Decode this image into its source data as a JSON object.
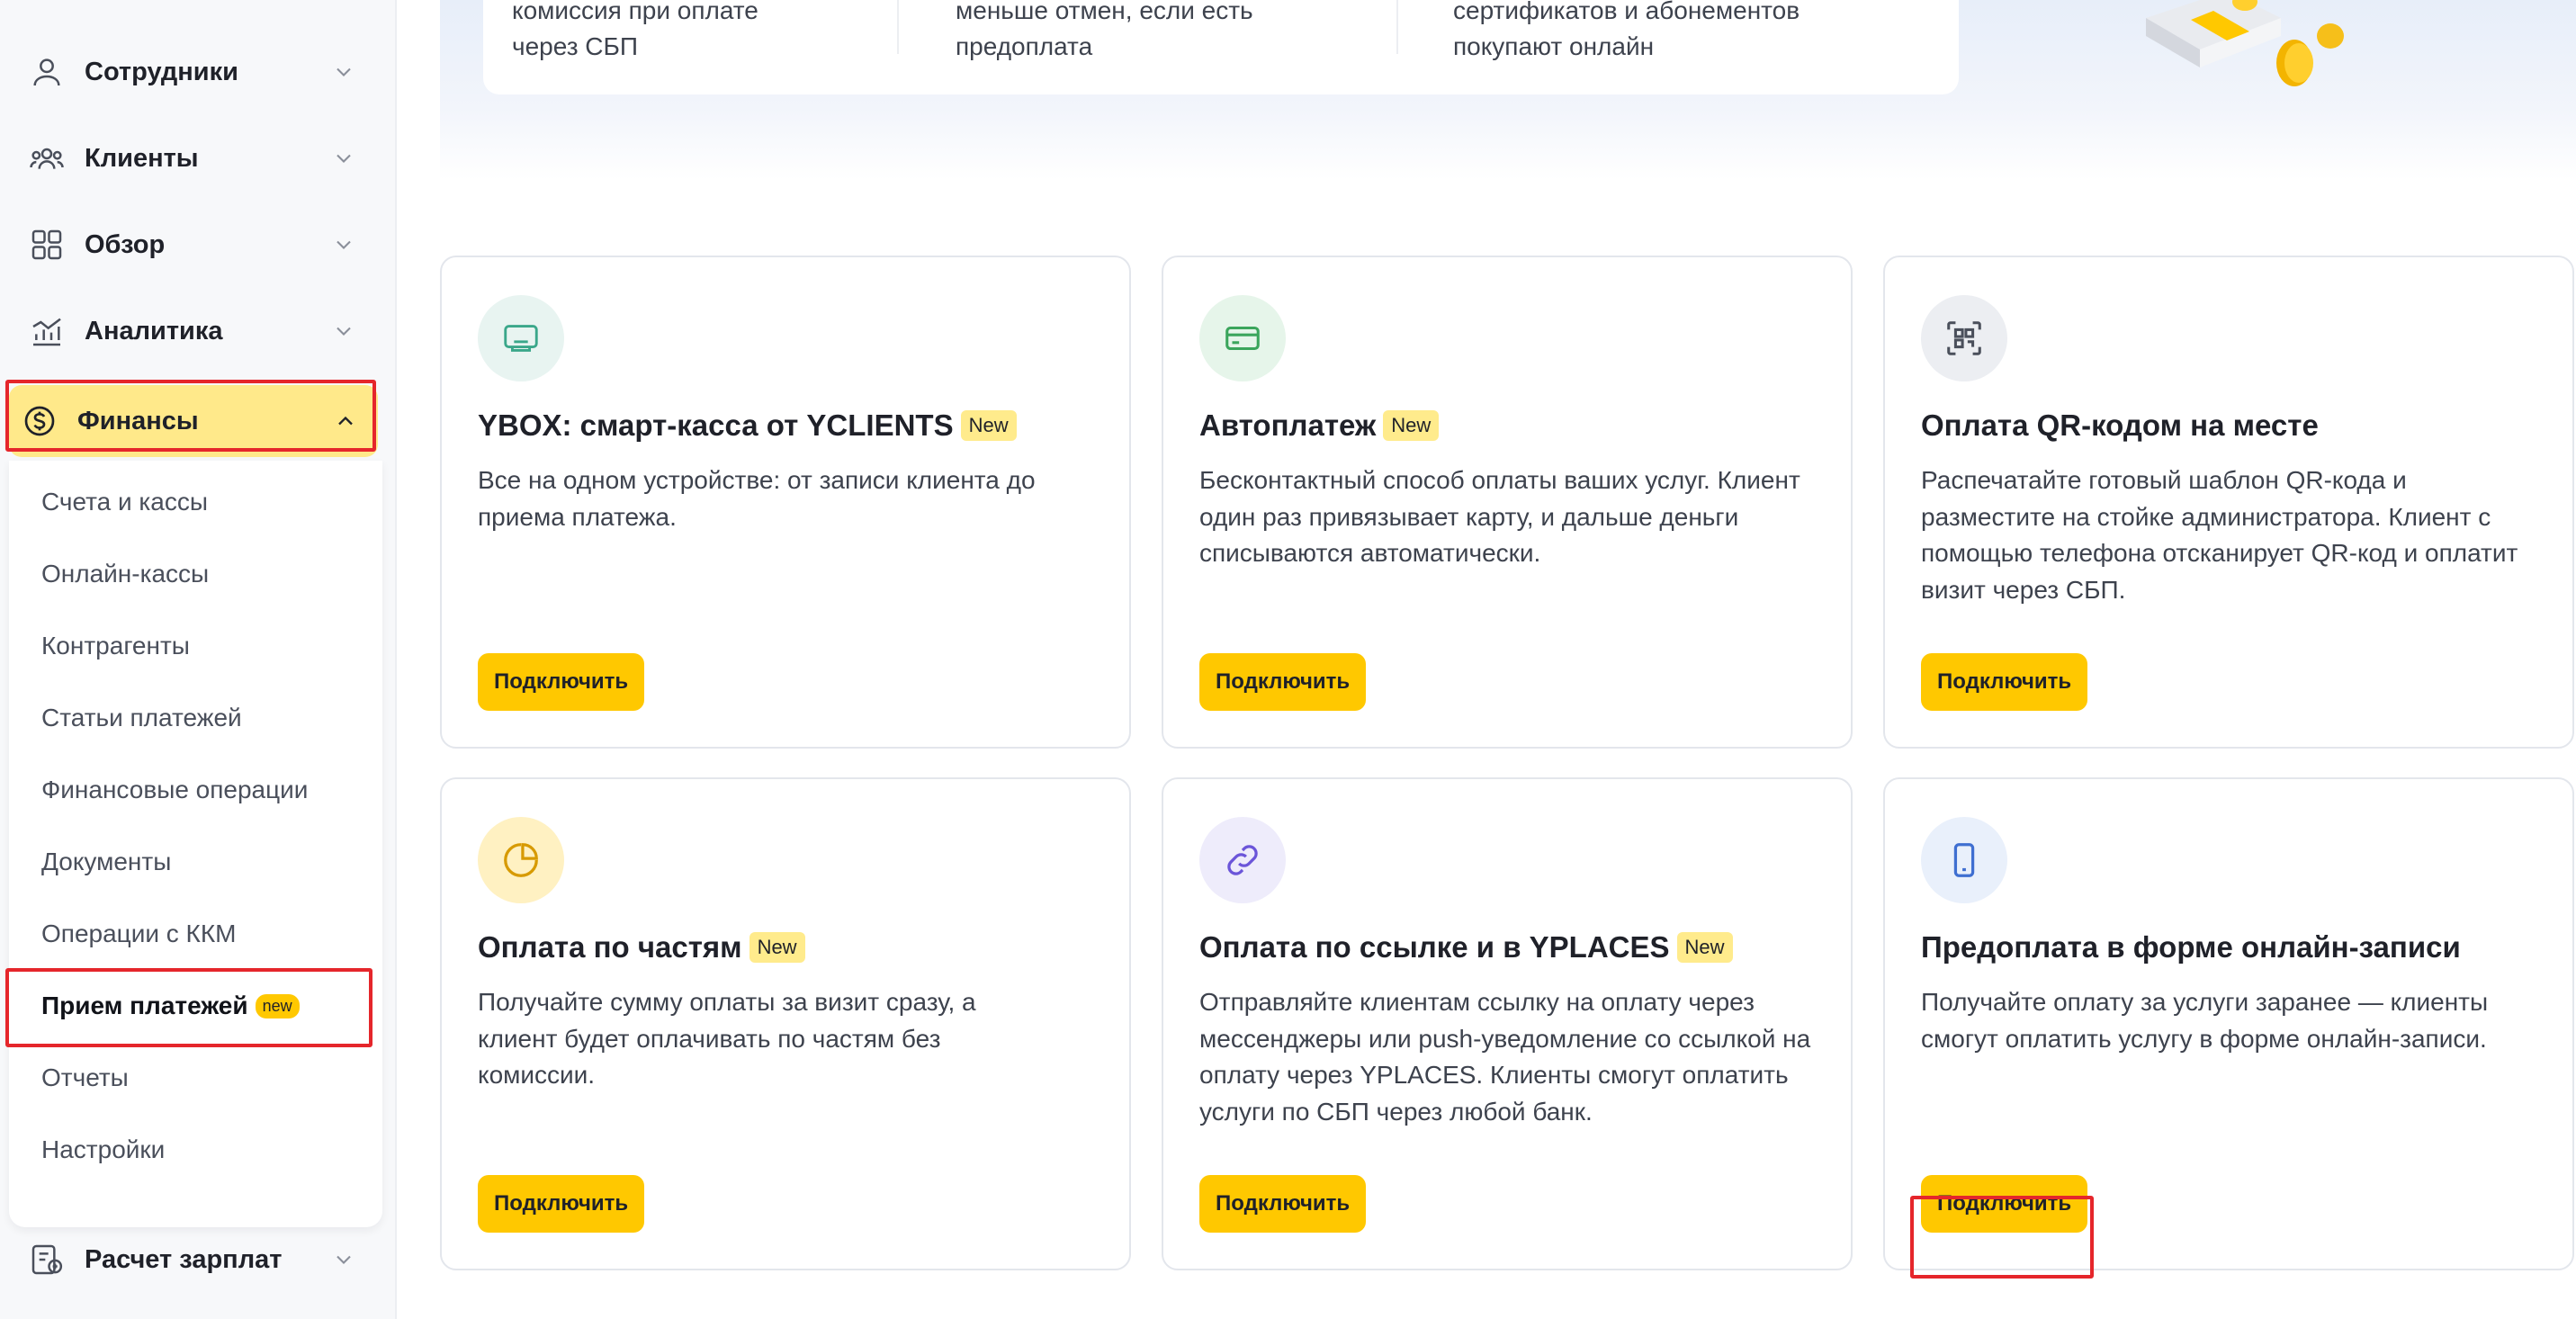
{
  "sidebar": {
    "items": [
      {
        "label": "Сотрудники",
        "icon": "person-icon"
      },
      {
        "label": "Клиенты",
        "icon": "people-icon"
      },
      {
        "label": "Обзор",
        "icon": "grid-icon"
      },
      {
        "label": "Аналитика",
        "icon": "analytics-icon"
      },
      {
        "label": "Финансы",
        "icon": "dollar-coin-icon"
      },
      {
        "label": "Расчет зарплат",
        "icon": "payroll-icon"
      }
    ],
    "finance_submenu": [
      {
        "label": "Счета и кассы"
      },
      {
        "label": "Онлайн-кассы"
      },
      {
        "label": "Контрагенты"
      },
      {
        "label": "Статьи платежей"
      },
      {
        "label": "Финансовые операции"
      },
      {
        "label": "Документы"
      },
      {
        "label": "Операции с ККМ"
      },
      {
        "label": "Прием платежей",
        "badge": "new",
        "active": true
      },
      {
        "label": "Отчеты"
      },
      {
        "label": "Настройки"
      }
    ]
  },
  "banner": {
    "columns": [
      {
        "line1": "комиссия при оплате",
        "line2": "через СБП"
      },
      {
        "line1": "меньше отмен, если есть",
        "line2": "предоплата"
      },
      {
        "line1": "сертификатов и абонементов",
        "line2": "покупают онлайн"
      }
    ]
  },
  "cards": [
    {
      "title": "YBOX: смарт-касса от YCLIENTS",
      "badge": "New",
      "icon": "terminal-icon",
      "icon_bg": "#e8f4f1",
      "desc": "Все на одном устройстве: от записи клиента до приема платежа.",
      "button": "Подключить"
    },
    {
      "title": "Автоплатеж",
      "badge": "New",
      "icon": "card-icon",
      "icon_bg": "#e6f5ea",
      "desc": "Бесконтактный способ оплаты ваших услуг. Клиент один раз привязывает карту, и дальше деньги списываются автоматически.",
      "button": "Подключить"
    },
    {
      "title": "Оплата QR-кодом на месте",
      "badge": "",
      "icon": "qr-code-icon",
      "icon_bg": "#eceef2",
      "desc": "Распечатайте готовый шаблон QR-кода и разместите на стойке администратора. Клиент с помощью телефона отсканирует QR-код и оплатит визит через СБП.",
      "button": "Подключить"
    },
    {
      "title": "Оплата по частям",
      "badge": "New",
      "icon": "pie-chart-icon",
      "icon_bg": "#fff1c2",
      "desc": "Получайте сумму оплаты за визит сразу, а клиент будет оплачивать по частям без комиссии.",
      "button": "Подключить"
    },
    {
      "title": "Оплата по ссылке и в YPLACES",
      "badge": "New",
      "icon": "link-icon",
      "icon_bg": "#eeecfb",
      "desc": "Отправляйте клиентам ссылку на оплату через мессенджеры или push-уведомление со ссылкой на оплату через YPLACES. Клиенты смогут оплатить услуги по СБП через любой банк.",
      "button": "Подключить"
    },
    {
      "title": "Предоплата в форме онлайн-записи",
      "badge": "",
      "icon": "phone-icon",
      "icon_bg": "#e9f0fb",
      "desc": "Получайте оплату за услуги заранее — клиенты смогут оплатить услугу в форме онлайн-записи.",
      "button": "Подключить"
    }
  ]
}
